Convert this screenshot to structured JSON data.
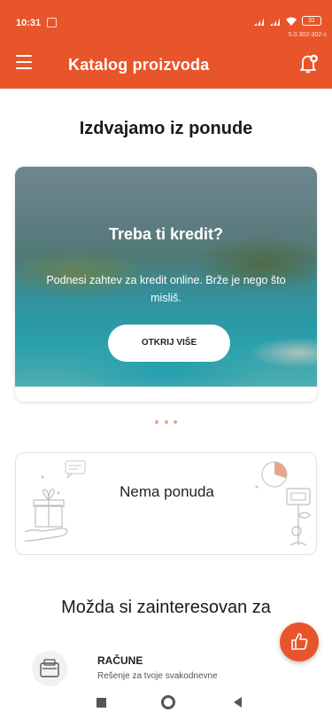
{
  "status_bar": {
    "time": "10:31",
    "battery": "31",
    "version": "5.0.302-302-c"
  },
  "header": {
    "title": "Katalog proizvoda"
  },
  "featured": {
    "title": "Izdvajamo iz ponude",
    "promo": {
      "title": "Treba ti kredit?",
      "description": "Podnesi zahtev za kredit online. Brže je nego što misliš.",
      "button_label": "OTKRIJ VIŠE"
    },
    "carousel_dots": 3
  },
  "offers": {
    "empty_label": "Nema ponuda"
  },
  "suggestions": {
    "title": "Možda si zainteresovan za",
    "items": [
      {
        "name": "RAČUNE",
        "description": "Rešenje za tvoje svakodnevne"
      }
    ]
  },
  "colors": {
    "brand": "#e8552a",
    "text": "#1a1a1a"
  }
}
